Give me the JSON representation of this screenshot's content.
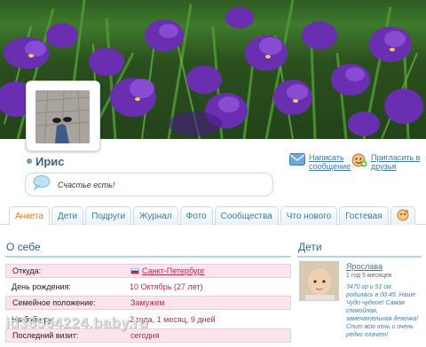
{
  "profile": {
    "name": "Ирис",
    "status_text": "Счастье есть!"
  },
  "actions": {
    "message_label": "Написать сообщение",
    "message_line1": "Написать",
    "message_line2": "сообщение",
    "add_friend_line1": "Пригласить в",
    "add_friend_line2": "друзья"
  },
  "tabs": [
    {
      "label": "Анкета",
      "active": true
    },
    {
      "label": "Дети"
    },
    {
      "label": "Подруги"
    },
    {
      "label": "Журнал"
    },
    {
      "label": "Фото"
    },
    {
      "label": "Сообщества"
    },
    {
      "label": "Что нового"
    },
    {
      "label": "Гостевая"
    }
  ],
  "about": {
    "title": "О себе",
    "rows": [
      {
        "label": "Откуда:",
        "value": "Санкт-Петербург"
      },
      {
        "label": "День рождения:",
        "value": "10 Октябрь (27 лет)"
      },
      {
        "label": "Семейное положение:",
        "value": "Замужем"
      },
      {
        "label": "На бэби.ру:",
        "value": "2 года, 1 месяц, 9 дней"
      },
      {
        "label": "Последний визит:",
        "value": "сегодня"
      }
    ]
  },
  "children": {
    "title": "Дети",
    "items": [
      {
        "name": "Ярослава",
        "age": "1 год 5 месяцев",
        "description": "3470 гр и 51 см, родилась в 00.45. Наше Чудо чудное! Самая спокойная, замечательная девочка! Спит всю ночь и очень редко плачет!"
      }
    ]
  },
  "watermark": "id36564224.baby.ru",
  "colors": {
    "tab_active": "#d97b2b",
    "link": "#3b79a6",
    "value": "#b12e4a",
    "section_title": "#2f6585",
    "row_highlight": "#fbe4ee"
  }
}
